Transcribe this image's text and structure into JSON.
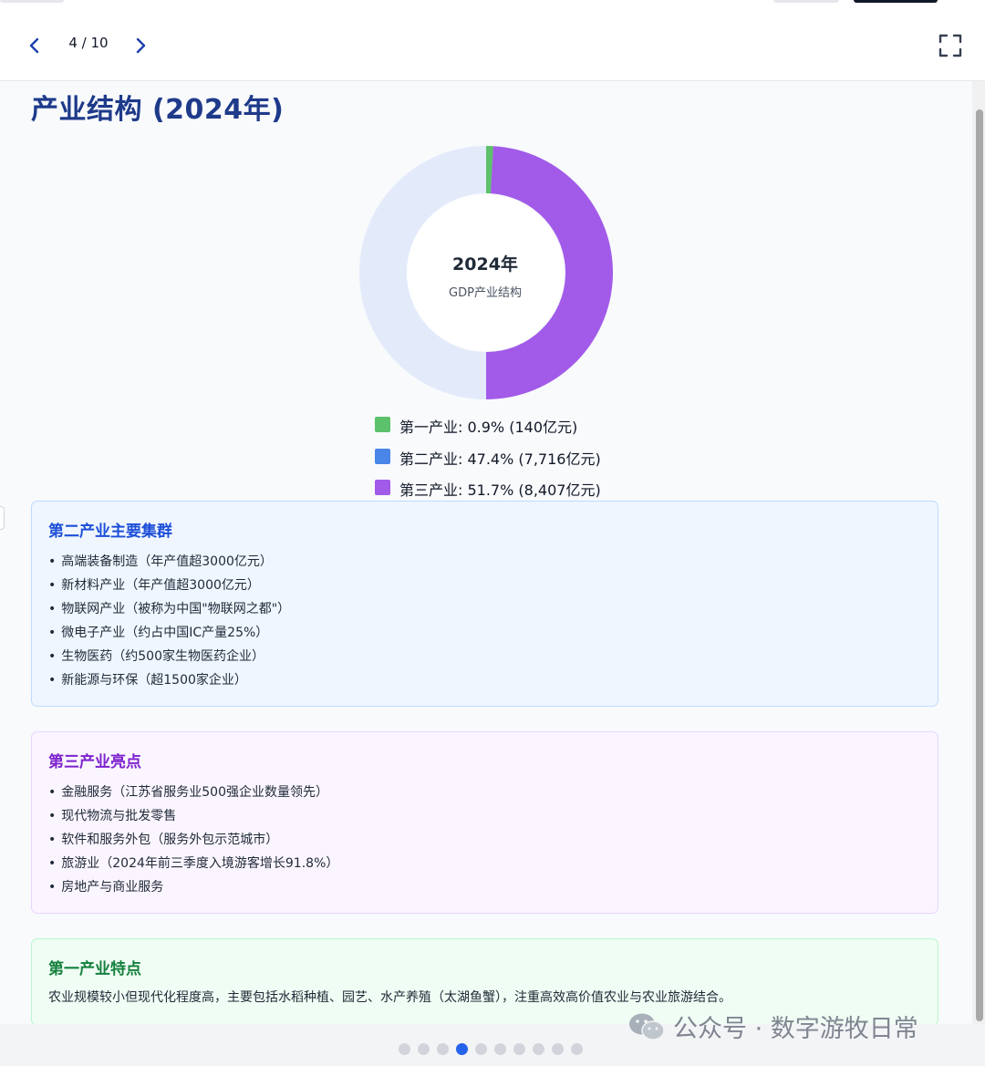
{
  "header": {
    "pager": "4 / 10"
  },
  "slide": {
    "title": "产业结构 (2024年)",
    "chart_center": {
      "year": "2024年",
      "subtitle": "GDP产业结构"
    },
    "legend": [
      {
        "label": "第一产业: 0.9% (140亿元)",
        "color": "#5cc16a"
      },
      {
        "label": "第二产业: 47.4% (7,716亿元)",
        "color": "#4a86e8"
      },
      {
        "label": "第三产业: 51.7% (8,407亿元)",
        "color": "#a25ae8"
      }
    ],
    "secondary_card": {
      "title": "第二产业主要集群",
      "items": [
        "高端装备制造（年产值超3000亿元）",
        "新材料产业（年产值超3000亿元）",
        "物联网产业（被称为中国\"物联网之都\"）",
        "微电子产业（约占中国IC产量25%）",
        "生物医药（约500家生物医药企业）",
        "新能源与环保（超1500家企业）"
      ]
    },
    "tertiary_card": {
      "title": "第三产业亮点",
      "items": [
        "金融服务（江苏省服务业500强企业数量领先）",
        "现代物流与批发零售",
        "软件和服务外包（服务外包示范城市）",
        "旅游业（2024年前三季度入境游客增长91.8%）",
        "房地产与商业服务"
      ]
    },
    "primary_card": {
      "title": "第一产业特点",
      "text": "农业规模较小但现代化程度高，主要包括水稻种植、园艺、水产养殖（太湖鱼蟹），注重高效高价值农业与农业旅游结合。"
    }
  },
  "chart_data": {
    "type": "pie",
    "categories": [
      "第一产业",
      "第二产业",
      "第三产业"
    ],
    "values": [
      0.9,
      47.4,
      51.7
    ],
    "amounts": [
      "140亿元",
      "7,716亿元",
      "8,407亿元"
    ],
    "rendered_portion_percent": [
      0.9,
      49.1
    ],
    "colors": [
      "#5cc16a",
      "#4a86e8",
      "#a25ae8"
    ],
    "donut": true
  },
  "footer": {
    "slide_count": 10,
    "active_index": 3,
    "watermark": "公众号 · 数字游牧日常"
  },
  "colors": {
    "title": "#1e3a8a",
    "secondary_title": "#1d4ed8",
    "tertiary_title": "#7e22ce",
    "primary_title": "#15803d",
    "active_dot": "#2563eb"
  }
}
